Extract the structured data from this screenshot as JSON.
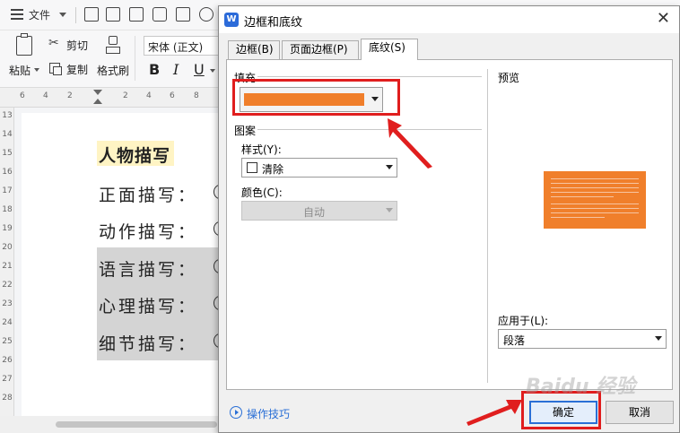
{
  "app": {
    "menu_label": "文件",
    "clipboard": {
      "paste": "粘贴",
      "cut": "剪切",
      "copy": "复制",
      "format_painter": "格式刷"
    },
    "font_name": "宋体 (正文)",
    "font_styles": {
      "bold": "B",
      "italic": "I",
      "underline": "U"
    },
    "ruler_h": [
      "6",
      "4",
      "2",
      "2",
      "4",
      "6",
      "8"
    ],
    "ruler_v": [
      "13",
      "14",
      "15",
      "16",
      "17",
      "18",
      "19",
      "20",
      "21",
      "22",
      "23",
      "24",
      "25",
      "26",
      "27",
      "28"
    ]
  },
  "document": {
    "heading": "人物描写",
    "lines": [
      "正面描写：",
      "动作描写：",
      "语言描写：",
      "心理描写：",
      "细节描写："
    ]
  },
  "dialog": {
    "logo_letter": "W",
    "title": "边框和底纹",
    "tabs": [
      {
        "label": "边框(B)",
        "active": false
      },
      {
        "label": "页面边框(P)",
        "active": false
      },
      {
        "label": "底纹(S)",
        "active": true
      }
    ],
    "fill": {
      "label": "填充",
      "color": "#f07f2b"
    },
    "pattern": {
      "label": "图案",
      "style_label": "样式(Y):",
      "style_value": "清除",
      "color_label": "颜色(C):",
      "color_value": "自动"
    },
    "preview_label": "预览",
    "apply_label": "应用于(L):",
    "apply_value": "段落",
    "tips_link": "操作技巧",
    "ok_label": "确定",
    "cancel_label": "取消"
  },
  "watermark": "Baidu 经验",
  "colors": {
    "accent_orange": "#f07f2b",
    "annotation_red": "#e01e1e",
    "link_blue": "#2a6fd6"
  }
}
